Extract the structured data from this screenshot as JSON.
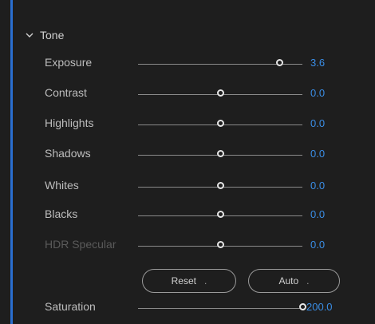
{
  "section": {
    "title": "Tone",
    "chevron_icon": "chevron-down-icon"
  },
  "sliders": [
    {
      "label": "Exposure",
      "value": "3.6",
      "position": 0.86,
      "disabled": false
    },
    {
      "label": "Contrast",
      "value": "0.0",
      "position": 0.5,
      "disabled": false
    },
    {
      "label": "Highlights",
      "value": "0.0",
      "position": 0.5,
      "disabled": false
    },
    {
      "label": "Shadows",
      "value": "0.0",
      "position": 0.5,
      "disabled": false
    },
    {
      "label": "Whites",
      "value": "0.0",
      "position": 0.5,
      "disabled": false
    },
    {
      "label": "Blacks",
      "value": "0.0",
      "position": 0.5,
      "disabled": false
    },
    {
      "label": "HDR Specular",
      "value": "0.0",
      "position": 0.5,
      "disabled": true
    }
  ],
  "buttons": {
    "reset_label": "Reset",
    "auto_label": "Auto"
  },
  "saturation": {
    "label": "Saturation",
    "value": "200.0",
    "position": 1.0
  },
  "colors": {
    "accent": "#3a8ee6",
    "rail": "#2a6fd0",
    "background": "#1e1e1e"
  }
}
